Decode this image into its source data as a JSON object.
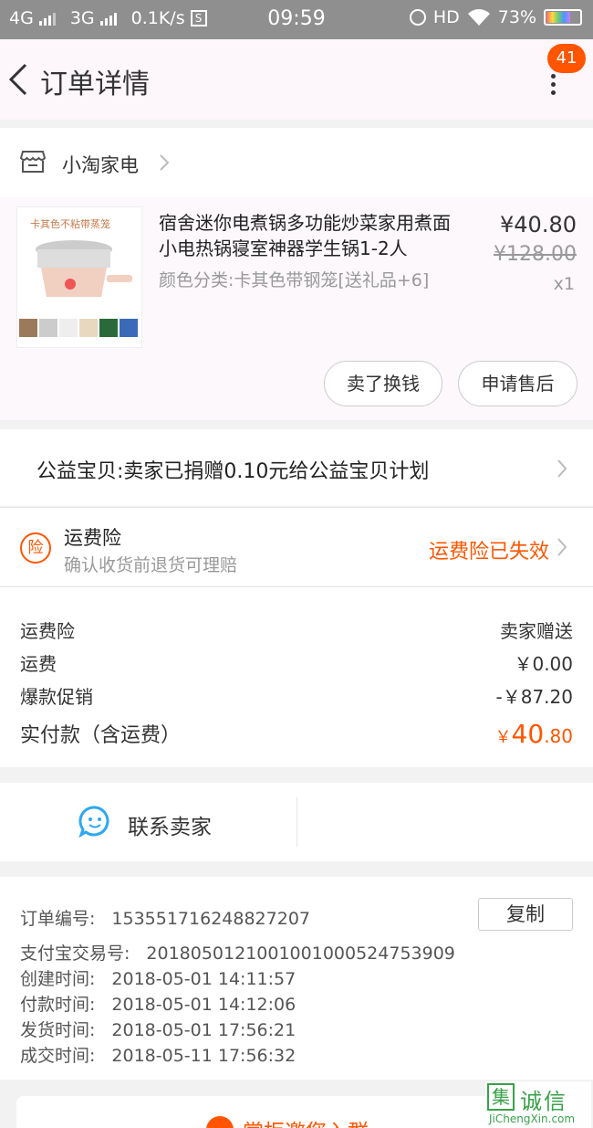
{
  "status_bar": {
    "net1": "4G",
    "net2": "3G",
    "speed": "0.1K/s",
    "time": "09:59",
    "hd": "HD",
    "battery": "73%"
  },
  "nav": {
    "title": "订单详情",
    "badge": "41"
  },
  "shop": {
    "name": "小淘家电"
  },
  "goods": {
    "thumb_caption": "卡其色不粘带蒸笼",
    "name": "宿舍迷你电煮锅多功能炒菜家用煮面小电热锅寝室神器学生锅1-2人",
    "sku": "颜色分类:卡其色带钢笼[送礼品+6]",
    "price": "¥40.80",
    "original_price": "¥128.00",
    "qty": "x1",
    "btn_resell": "卖了换钱",
    "btn_aftersale": "申请售后"
  },
  "charity": {
    "text": "公益宝贝:卖家已捐赠0.10元给公益宝贝计划"
  },
  "insurance": {
    "icon_text": "险",
    "title": "运费险",
    "subtitle": "确认收货前退货可理赔",
    "status": "运费险已失效"
  },
  "fees": [
    {
      "label": "运费险",
      "value": "卖家赠送"
    },
    {
      "label": "运费",
      "value": "￥0.00"
    },
    {
      "label": "爆款促销",
      "value": "-￥87.20"
    }
  ],
  "total": {
    "label": "实付款（含运费）",
    "yen": "￥",
    "int": "40",
    "dec": ".80"
  },
  "contact": {
    "label": "联系卖家"
  },
  "order_info": {
    "order_no_label": "订单编号:",
    "order_no": "153551716248827207",
    "copy_label": "复制",
    "alipay_label": "支付宝交易号:",
    "alipay_no": "2018050121001001000524753909",
    "created_label": "创建时间:",
    "created": "2018-05-01 14:11:57",
    "paid_label": "付款时间:",
    "paid": "2018-05-01 14:12:06",
    "shipped_label": "发货时间:",
    "shipped": "2018-05-01 17:56:21",
    "done_label": "成交时间:",
    "done": "2018-05-11 17:56:32"
  },
  "bottom": {
    "text": "掌柜邀您入群"
  },
  "watermark": {
    "mark": "集",
    "name": "诚信",
    "url": "JiChengXin.com"
  },
  "colors": {
    "accent": "#ff5500",
    "contact_icon": "#2fa8f0"
  }
}
